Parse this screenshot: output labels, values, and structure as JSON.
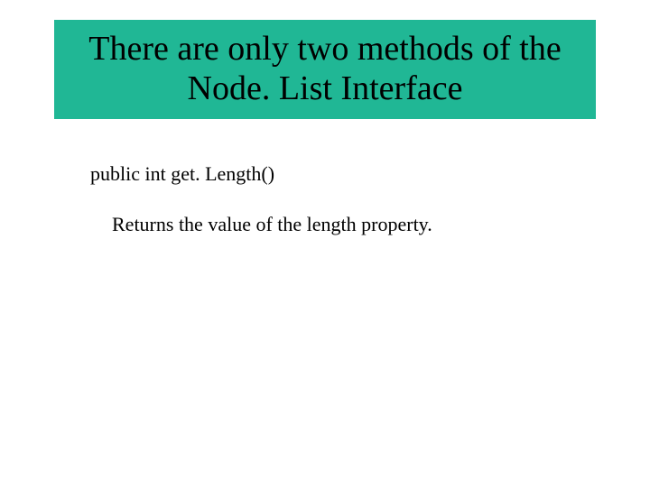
{
  "title": "There are only two methods of the Node. List Interface",
  "body": {
    "method_signature": "public int get. Length()",
    "method_description": "Returns the value of the length property."
  },
  "colors": {
    "title_bg": "#20b795"
  }
}
